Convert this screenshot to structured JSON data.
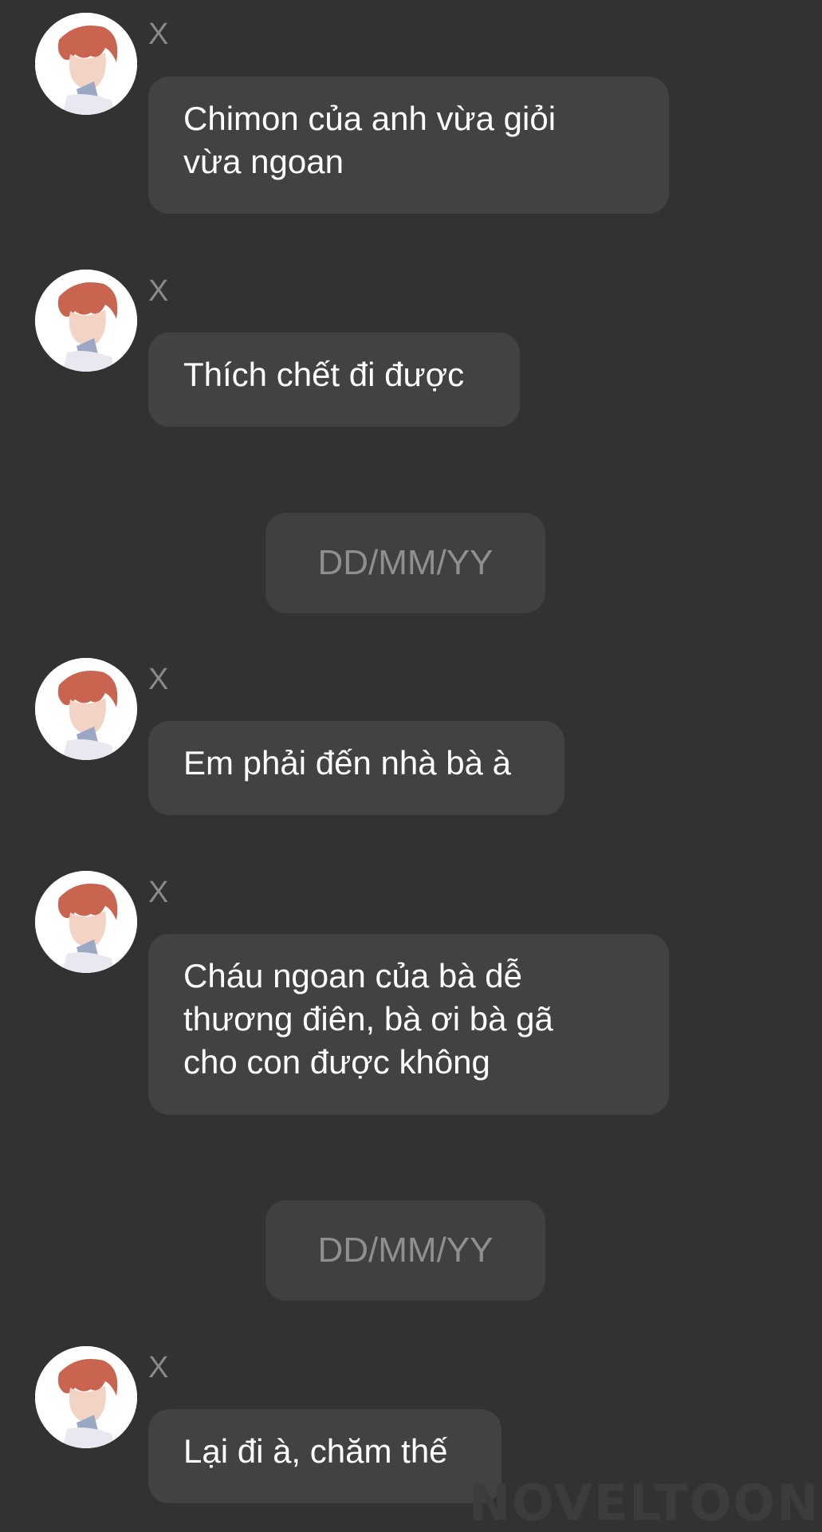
{
  "messages": [
    {
      "sender": "X",
      "text": "Chimon của anh vừa giỏi\nvừa ngoan"
    },
    {
      "sender": "X",
      "text": "Thích chết đi được"
    },
    {
      "sender": "X",
      "text": "Em phải đến nhà bà à"
    },
    {
      "sender": "X",
      "text": "Cháu ngoan của bà dễ\nthương điên, bà ơi bà gã\ncho con được không"
    },
    {
      "sender": "X",
      "text": "Lại đi à, chăm thế"
    }
  ],
  "dates": [
    "DD/MM/YY",
    "DD/MM/YY"
  ],
  "watermark": "NOVELTOON",
  "colors": {
    "background": "#323232",
    "bubble": "#424242",
    "date_chip": "#404040",
    "sender_text": "#8a8a8a",
    "message_text": "#ffffff"
  },
  "icons": {
    "avatar": "avatar-icon"
  }
}
